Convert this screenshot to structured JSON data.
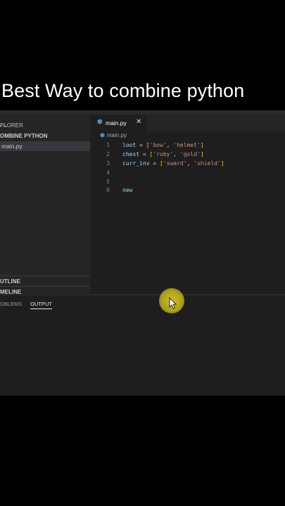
{
  "caption": "Best Way to combine python",
  "sidebar": {
    "header": "PLORER",
    "more_glyph": "···",
    "folder": "OMBINE PYTHON",
    "file": "main.py",
    "outline": "UTLINE",
    "timeline": "MELINE"
  },
  "tab": {
    "label": "main.py",
    "close_glyph": "✕"
  },
  "breadcrumb": "main.py",
  "code_lines": [
    {
      "num": "1",
      "text": "loot = ['bow', 'helmet']"
    },
    {
      "num": "2",
      "text": "chest = ['ruby', 'gold']"
    },
    {
      "num": "3",
      "text": "curr_inv = ['sward', 'shield']"
    },
    {
      "num": "4",
      "text": ""
    },
    {
      "num": "5",
      "text": ""
    },
    {
      "num": "6",
      "text": "new"
    }
  ],
  "panel": {
    "problems": "OBLEMS",
    "output": "OUTPUT"
  },
  "colors": {
    "python_icon": "#4b8bbe",
    "cursor_highlight": "#d6c628"
  }
}
